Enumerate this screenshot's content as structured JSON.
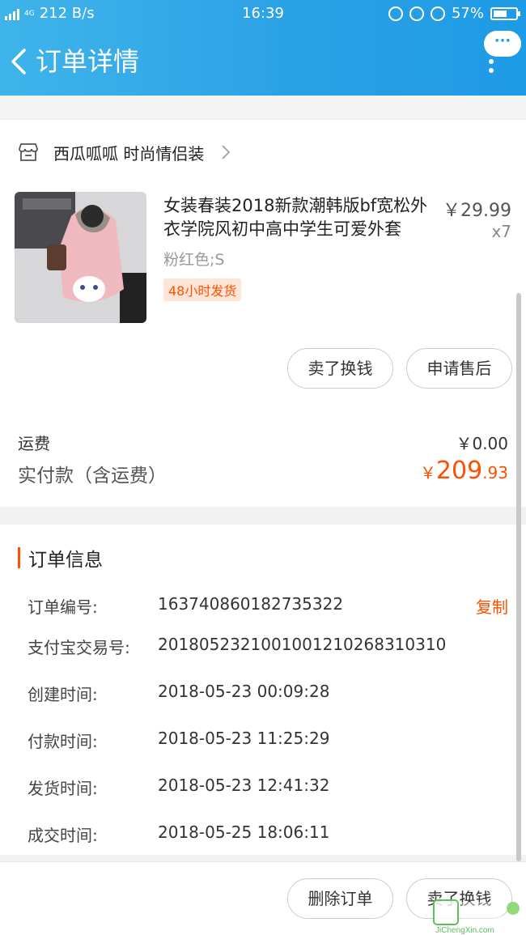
{
  "status_bar": {
    "network_speed": "212 B/s",
    "net_type": "4G",
    "time": "16:39",
    "battery": "57%"
  },
  "nav": {
    "title": "订单详情",
    "more_label": "···"
  },
  "shop": {
    "name": "西瓜呱呱 时尚情侣装"
  },
  "product": {
    "title": "女装春装2018新款潮韩版bf宽松外衣学院风初中高中学生可爱外套",
    "price": "￥29.99",
    "quantity": "x7",
    "sku": "粉红色;S",
    "badge": "48小时发货",
    "buttons": {
      "sell": "卖了换钱",
      "after_sale": "申请售后"
    }
  },
  "summary": {
    "shipping_label": "运费",
    "shipping_value": "￥0.00",
    "paid_label": "实付款（含运费）",
    "paid_currency": "￥",
    "paid_integer": "209",
    "paid_decimal": ".93"
  },
  "order_info": {
    "title": "订单信息",
    "copy_label": "复制",
    "rows": [
      {
        "label": "订单编号:",
        "value": "163740860182735322"
      },
      {
        "label": "支付宝交易号:",
        "value": "2018052321001001210268310310"
      },
      {
        "label": "创建时间:",
        "value": "2018-05-23 00:09:28"
      },
      {
        "label": "付款时间:",
        "value": "2018-05-23 11:25:29"
      },
      {
        "label": "发货时间:",
        "value": "2018-05-23 12:41:32"
      },
      {
        "label": "成交时间:",
        "value": "2018-05-25 18:06:11"
      }
    ]
  },
  "bottom_bar": {
    "delete_label": "删除订单",
    "sell_label": "卖了换钱"
  },
  "watermark": {
    "text": "JiChengXin.com"
  },
  "colors": {
    "header": "#2aa0e6",
    "accent": "#ff5000"
  }
}
